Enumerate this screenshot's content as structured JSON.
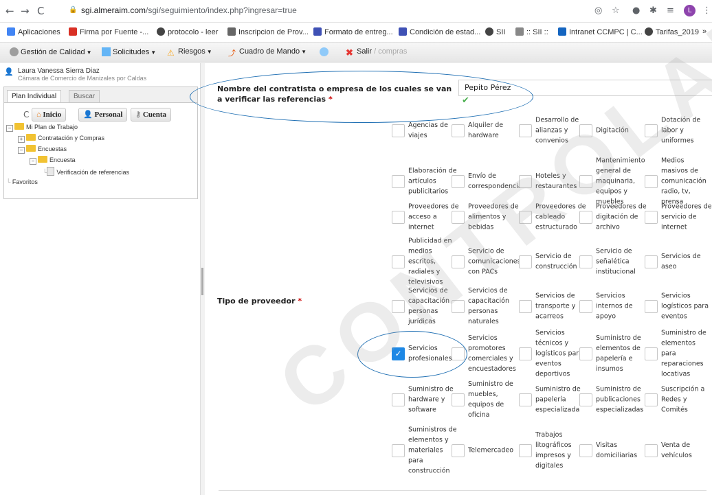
{
  "browser": {
    "url_host": "sgi.almeraim.com",
    "url_path": "/sgi/seguimiento/index.php?ingresar=true",
    "profile_initial": "L",
    "bookmarks": [
      "Aplicaciones",
      "Firma por Fuente -...",
      "protocolo - leer",
      "Inscripcion de Prov...",
      "Formato de entreg...",
      "Condición de estad...",
      "SII",
      ":: SII ::",
      "Intranet CCMPC | C...",
      "Tarifas_2019",
      "»"
    ]
  },
  "menubar": {
    "items": [
      "Gestión de Calidad",
      "Solicitudes",
      "Riesgos",
      "Cuadro de Mando"
    ],
    "exit_label": "Salir",
    "exit_crumb": "/ compras"
  },
  "user": {
    "name": "Laura Vanessa Sierra Diaz",
    "org": "Cámara de Comercio de Manizales por Caldas"
  },
  "left_panel": {
    "tabs": [
      "Plan Individual",
      "Buscar"
    ],
    "buttons": [
      "Inicio",
      "Personal",
      "Cuenta"
    ],
    "tree": [
      "Mi Plan de Trabajo",
      "Contratación y Compras",
      "Encuestas",
      "Encuesta",
      "Verificación de referencias",
      "Favoritos"
    ]
  },
  "form": {
    "contractor_label": "Nombre del contratista o empresa de los cuales se van a verificar las referencias",
    "contractor_value": "Pepito Pérez",
    "provider_type_label": "Tipo de proveedor",
    "required_mark": "*",
    "options": [
      {
        "label": "Agencias de viajes",
        "checked": false
      },
      {
        "label": "Alquiler de hardware",
        "checked": false
      },
      {
        "label": "Desarrollo de alianzas y convenios",
        "checked": false
      },
      {
        "label": "Digitación",
        "checked": false
      },
      {
        "label": "Dotación de labor y uniformes",
        "checked": false
      },
      {
        "label": "Elaboración de artículos publicitarios",
        "checked": false
      },
      {
        "label": "Envío de correspondencia",
        "checked": false
      },
      {
        "label": "Hoteles y restaurantes",
        "checked": false
      },
      {
        "label": "Mantenimiento general de maquinaria, equipos y muebles",
        "checked": false
      },
      {
        "label": "Medios masivos de comunicación radio, tv, prensa",
        "checked": false
      },
      {
        "label": "Proveedores de acceso a internet",
        "checked": false
      },
      {
        "label": "Proveedores de alimentos y bebidas",
        "checked": false
      },
      {
        "label": "Proveedores de cableado estructurado",
        "checked": false
      },
      {
        "label": "Proveedores de digitación de archivo",
        "checked": false
      },
      {
        "label": "Proveedores de servicio de internet",
        "checked": false
      },
      {
        "label": "Publicidad en medios escritos, radiales y televisivos",
        "checked": false
      },
      {
        "label": "Servicio de comunicaciones con PACs",
        "checked": false
      },
      {
        "label": "Servicio de construcción",
        "checked": false
      },
      {
        "label": "Servicio de señalética institucional",
        "checked": false
      },
      {
        "label": "Servicios de aseo",
        "checked": false
      },
      {
        "label": "Servicios de capacitación personas jurídicas",
        "checked": false
      },
      {
        "label": "Servicios de capacitación personas naturales",
        "checked": false
      },
      {
        "label": "Servicios de transporte y acarreos",
        "checked": false
      },
      {
        "label": "Servicios internos de apoyo",
        "checked": false
      },
      {
        "label": "Servicios logísticos para eventos",
        "checked": false
      },
      {
        "label": "Servicios profesionales",
        "checked": true
      },
      {
        "label": "Servicios promotores comerciales y encuestadores",
        "checked": false
      },
      {
        "label": "Servicios técnicos y logísticos para eventos deportivos",
        "checked": false
      },
      {
        "label": "Suministro de elementos de papelería e insumos",
        "checked": false
      },
      {
        "label": "Suministro de elementos para reparaciones locativas",
        "checked": false
      },
      {
        "label": "Suministro de hardware y software",
        "checked": false
      },
      {
        "label": "Suministro de muebles, equipos de oficina",
        "checked": false
      },
      {
        "label": "Suministro de papelería especializada",
        "checked": false
      },
      {
        "label": "Suministro de publicaciones especializadas",
        "checked": false
      },
      {
        "label": "Suscripción a Redes y Comités",
        "checked": false
      },
      {
        "label": "Suministros de elementos y materiales para construcción",
        "checked": false
      },
      {
        "label": "Telemercadeo",
        "checked": false
      },
      {
        "label": "Trabajos litográficos impresos y digitales",
        "checked": false
      },
      {
        "label": "Visitas domiciliarias",
        "checked": false
      },
      {
        "label": "Venta de vehículos",
        "checked": false
      }
    ]
  },
  "watermark": "CONTROLADA"
}
